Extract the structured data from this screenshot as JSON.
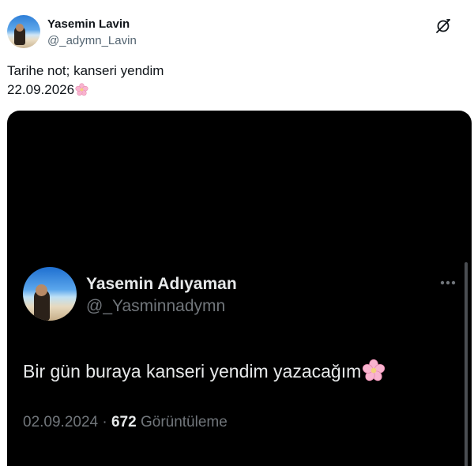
{
  "tweet": {
    "author": {
      "name": "Yasemin Lavin",
      "handle": "@_adymn_Lavin",
      "avatar_icon": "profile-photo-beach"
    },
    "grok_icon": "grok-icon",
    "text_line1": "Tarihe not; kanseri yendim",
    "text_line2": "22.09.2026",
    "emoji": "cherry-blossom"
  },
  "embedded": {
    "author": {
      "name": "Yasemin Adıyaman",
      "handle": "@_Yasminnadymn",
      "avatar_icon": "profile-photo-beach"
    },
    "more_icon": "more-icon",
    "text": "Bir gün buraya kanseri yendim yazacağım",
    "emoji": "cherry-blossom",
    "date": "02.09.2024",
    "separator": " · ",
    "views_count": "672",
    "views_label": "Görüntüleme"
  },
  "colors": {
    "text_primary": "#0f1419",
    "text_secondary": "#536471",
    "dark_bg": "#000000",
    "dark_text": "#e7e9ea",
    "dark_muted": "#71767b",
    "blossom": "#f7a8c8"
  }
}
